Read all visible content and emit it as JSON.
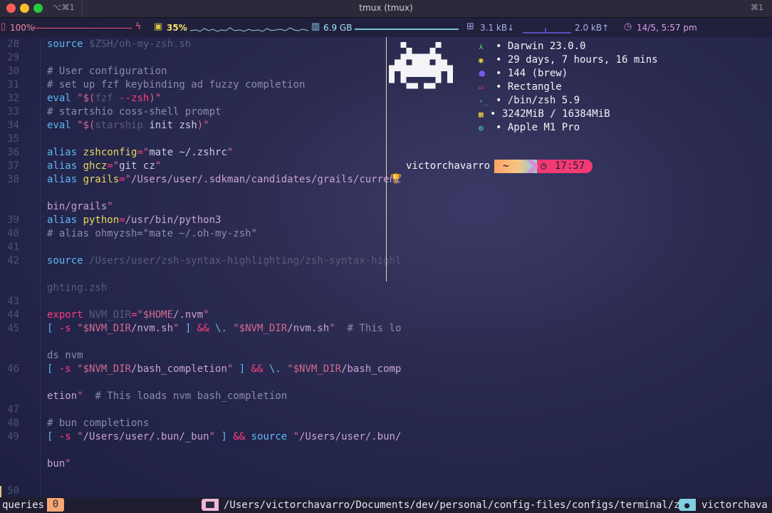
{
  "window": {
    "tab_shortcut": "⌥⌘1",
    "title": "tmux (tmux)",
    "shortcut_right": "⌘1"
  },
  "stats": {
    "battery": "100%",
    "cpu": "35%",
    "memory": "6.9 GB",
    "net_down": "3.1 kB↓",
    "net_up": "2.0 kB↑",
    "datetime": "14/5, 5:57 pm"
  },
  "editor": {
    "lines": [
      {
        "n": "28",
        "segs": [
          [
            "c-kw",
            "source "
          ],
          [
            "c-dim",
            "$ZSH/oh-my-zsh.sh"
          ]
        ]
      },
      {
        "n": "29",
        "segs": []
      },
      {
        "n": "30",
        "segs": [
          [
            "c-cmt",
            "# User configuration"
          ]
        ]
      },
      {
        "n": "31",
        "segs": [
          [
            "c-cmt",
            "# set up fzf keybinding ad fuzzy completion"
          ]
        ]
      },
      {
        "n": "32",
        "segs": [
          [
            "c-kw",
            "eval "
          ],
          [
            "c-str",
            "\"$("
          ],
          [
            "c-dim",
            "fzf "
          ],
          [
            "c-pink",
            "--zsh"
          ],
          [
            "c-str",
            ")\""
          ]
        ]
      },
      {
        "n": "33",
        "segs": [
          [
            "c-cmt",
            "# startshio coss-shell prompt"
          ]
        ]
      },
      {
        "n": "34",
        "segs": [
          [
            "c-kw",
            "eval "
          ],
          [
            "c-str",
            "\"$("
          ],
          [
            "c-dim",
            "starship "
          ],
          [
            "c-plain",
            "init zsh"
          ],
          [
            "c-str",
            ")\""
          ]
        ]
      },
      {
        "n": "35",
        "segs": []
      },
      {
        "n": "36",
        "segs": [
          [
            "c-kw",
            "alias "
          ],
          [
            "c-yel",
            "zshconfig"
          ],
          [
            "c-pink",
            "="
          ],
          [
            "c-str",
            "\""
          ],
          [
            "c-plain",
            "mate ~/.zshrc"
          ],
          [
            "c-str",
            "\""
          ]
        ]
      },
      {
        "n": "37",
        "segs": [
          [
            "c-kw",
            "alias "
          ],
          [
            "c-yel",
            "ghcz"
          ],
          [
            "c-pink",
            "="
          ],
          [
            "c-str",
            "\""
          ],
          [
            "c-plain",
            "git cz"
          ],
          [
            "c-str",
            "\""
          ]
        ]
      },
      {
        "n": "38",
        "segs": [
          [
            "c-kw",
            "alias "
          ],
          [
            "c-yel",
            "grails"
          ],
          [
            "c-pink",
            "="
          ],
          [
            "c-str",
            "\""
          ],
          [
            "c-path",
            "/Users/user/.sdkman/candidates/grails/current"
          ]
        ]
      },
      {
        "n": "",
        "segs": []
      },
      {
        "n": "",
        "segs": [
          [
            "c-path",
            "bin/grails"
          ],
          [
            "c-str",
            "\""
          ]
        ]
      },
      {
        "n": "39",
        "segs": [
          [
            "c-kw",
            "alias "
          ],
          [
            "c-yel",
            "python"
          ],
          [
            "c-pink",
            "="
          ],
          [
            "c-path",
            "/usr/bin/python3"
          ]
        ]
      },
      {
        "n": "40",
        "segs": [
          [
            "c-cmt",
            "# alias ohmyzsh=\"mate ~/.oh-my-zsh\""
          ]
        ]
      },
      {
        "n": "41",
        "segs": []
      },
      {
        "n": "42",
        "segs": [
          [
            "c-kw",
            "source "
          ],
          [
            "c-dim",
            "/Users/user/zsh-syntax-highlighting/zsh-syntax-highl"
          ]
        ]
      },
      {
        "n": "",
        "segs": []
      },
      {
        "n": "",
        "segs": [
          [
            "c-dim",
            "ghting.zsh"
          ]
        ]
      },
      {
        "n": "43",
        "segs": []
      },
      {
        "n": "44",
        "segs": [
          [
            "c-pink",
            "export "
          ],
          [
            "c-dim",
            "NVM_DIR"
          ],
          [
            "c-pink",
            "="
          ],
          [
            "c-str",
            "\"$HOME"
          ],
          [
            "c-path",
            "/.nvm"
          ],
          [
            "c-str",
            "\""
          ]
        ]
      },
      {
        "n": "45",
        "segs": [
          [
            "c-kw",
            "[ "
          ],
          [
            "c-pink",
            "-s "
          ],
          [
            "c-str",
            "\"$NVM_DIR"
          ],
          [
            "c-path",
            "/nvm.sh"
          ],
          [
            "c-str",
            "\""
          ],
          [
            "c-kw",
            " ] "
          ],
          [
            "c-pink",
            "&& "
          ],
          [
            "c-fn",
            "\\. "
          ],
          [
            "c-str",
            "\"$NVM_DIR"
          ],
          [
            "c-path",
            "/nvm.sh"
          ],
          [
            "c-str",
            "\""
          ],
          [
            "c-cmt",
            "  # This lo"
          ]
        ]
      },
      {
        "n": "",
        "segs": []
      },
      {
        "n": "",
        "segs": [
          [
            "c-cmt",
            "ds nvm"
          ]
        ]
      },
      {
        "n": "46",
        "segs": [
          [
            "c-kw",
            "[ "
          ],
          [
            "c-pink",
            "-s "
          ],
          [
            "c-str",
            "\"$NVM_DIR"
          ],
          [
            "c-path",
            "/bash_completion"
          ],
          [
            "c-str",
            "\""
          ],
          [
            "c-kw",
            " ] "
          ],
          [
            "c-pink",
            "&& "
          ],
          [
            "c-fn",
            "\\. "
          ],
          [
            "c-str",
            "\"$NVM_DIR"
          ],
          [
            "c-path",
            "/bash_comp"
          ]
        ]
      },
      {
        "n": "",
        "segs": []
      },
      {
        "n": "",
        "segs": [
          [
            "c-path",
            "etion"
          ],
          [
            "c-str",
            "\""
          ],
          [
            "c-cmt",
            "  # This loads nvm bash_completion"
          ]
        ]
      },
      {
        "n": "47",
        "segs": []
      },
      {
        "n": "48",
        "segs": [
          [
            "c-cmt",
            "# bun completions"
          ]
        ]
      },
      {
        "n": "49",
        "segs": [
          [
            "c-kw",
            "[ "
          ],
          [
            "c-pink",
            "-s "
          ],
          [
            "c-str",
            "\""
          ],
          [
            "c-path",
            "/Users/user/.bun/_bun"
          ],
          [
            "c-str",
            "\""
          ],
          [
            "c-kw",
            " ] "
          ],
          [
            "c-pink",
            "&& "
          ],
          [
            "c-kw",
            "source "
          ],
          [
            "c-str",
            "\""
          ],
          [
            "c-path",
            "/Users/user/.bun/"
          ]
        ]
      },
      {
        "n": "",
        "segs": []
      },
      {
        "n": "",
        "segs": [
          [
            "c-path",
            "bun"
          ],
          [
            "c-str",
            "\""
          ]
        ]
      },
      {
        "n": "",
        "segs": []
      },
      {
        "n": "50",
        "segs": []
      }
    ]
  },
  "fetch": {
    "rows": [
      {
        "icon": "⋏",
        "color": "#4ecb71",
        "text": "• Darwin 23.0.0"
      },
      {
        "icon": "◉",
        "color": "#f2d43a",
        "text": "• 29 days, 7 hours, 16 mins"
      },
      {
        "icon": "⬢",
        "color": "#7a58e8",
        "text": "• 144 (brew)"
      },
      {
        "icon": "▭",
        "color": "#f0436e",
        "text": "• Rectangle"
      },
      {
        "icon": "›_",
        "color": "#4ecb71",
        "text": "• /bin/zsh 5.9"
      },
      {
        "icon": "▦",
        "color": "#f2d43a",
        "text": "• 3242MiB / 16384MiB"
      },
      {
        "icon": "◍",
        "color": "#42b8d8",
        "text": "• Apple M1 Pro"
      }
    ]
  },
  "prompt": {
    "user": "victorchavarro",
    "dir": "~",
    "time": "17:57"
  },
  "status": {
    "mode": "queries",
    "count": "0",
    "path": "/Users/victorchavarro/Documents/dev/personal/config-files/configs/terminal/zsh",
    "user": "victorchava"
  }
}
